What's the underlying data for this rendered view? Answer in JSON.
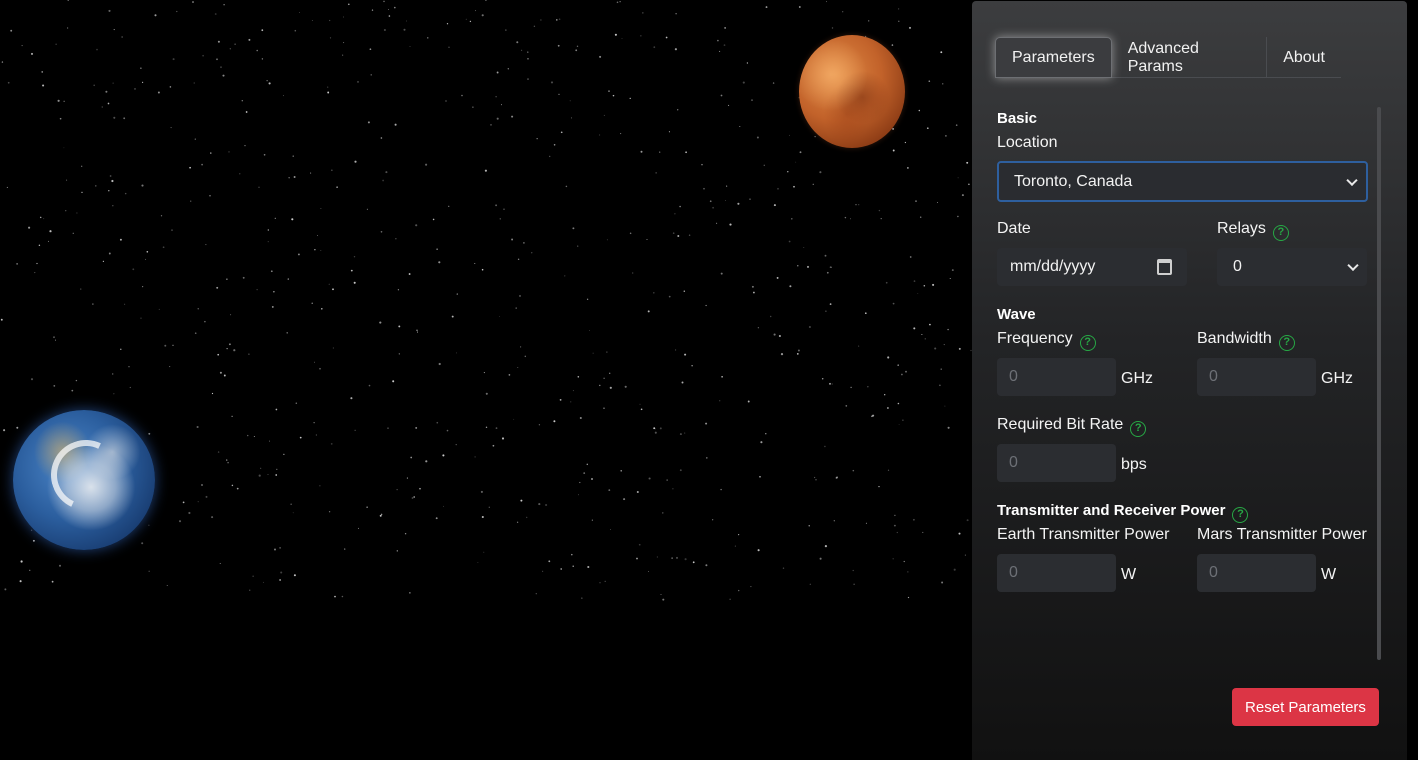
{
  "tabs": [
    {
      "label": "Parameters"
    },
    {
      "label": "Advanced Params"
    },
    {
      "label": "About"
    }
  ],
  "basic": {
    "title": "Basic",
    "location_label": "Location",
    "location_value": "Toronto, Canada",
    "date_label": "Date",
    "date_placeholder": "mm/dd/yyyy",
    "relays_label": "Relays",
    "relays_value": "0"
  },
  "wave": {
    "title": "Wave",
    "frequency_label": "Frequency",
    "frequency_value": "0",
    "frequency_unit": "GHz",
    "bandwidth_label": "Bandwidth",
    "bandwidth_value": "0",
    "bandwidth_unit": "GHz",
    "bitrate_label": "Required Bit Rate",
    "bitrate_value": "0",
    "bitrate_unit": "bps"
  },
  "power": {
    "title": "Transmitter and Receiver Power",
    "earth_label": "Earth Transmitter Power",
    "earth_value": "0",
    "earth_unit": "W",
    "mars_label": "Mars Transmitter Power",
    "mars_value": "0",
    "mars_unit": "W"
  },
  "reset_label": "Reset Parameters",
  "help_glyph": "?",
  "colors": {
    "accent_danger": "#dc3545",
    "help_green": "#27a745",
    "select_focus": "#2e5f9e"
  }
}
